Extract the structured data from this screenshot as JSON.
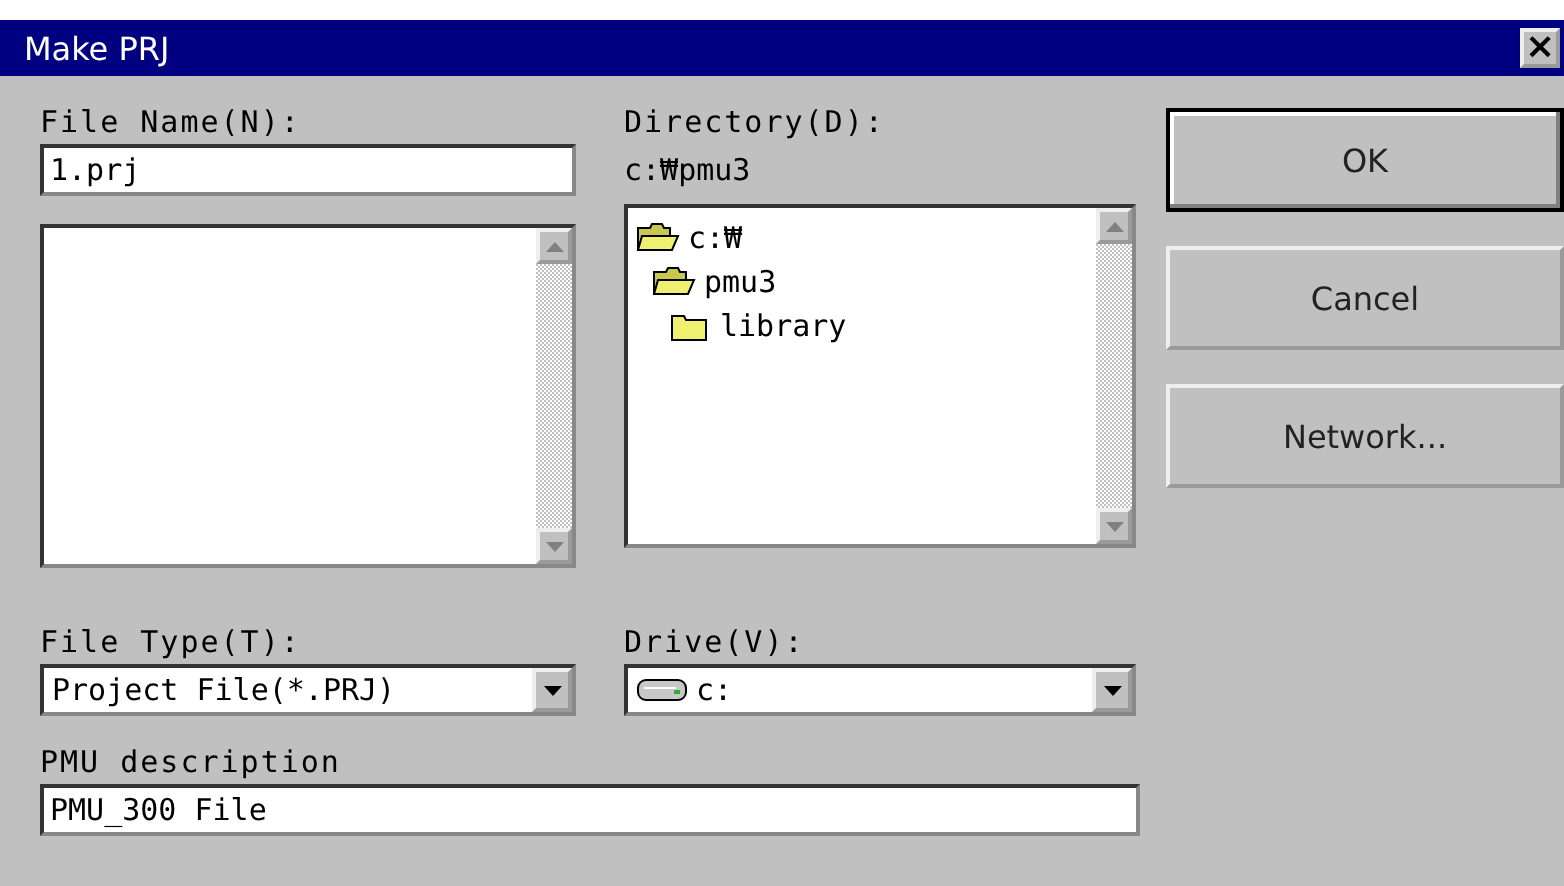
{
  "window": {
    "title": "Make PRJ",
    "close": "×"
  },
  "file_name": {
    "label": "File Name(N):",
    "value": "1.prj"
  },
  "directory": {
    "label": "Directory(D):",
    "path": "c:₩pmu3",
    "tree": [
      {
        "name": "c:₩",
        "expanded": true,
        "children": [
          {
            "name": "pmu3",
            "expanded": true,
            "children": [
              {
                "name": "library",
                "expanded": false
              }
            ]
          }
        ]
      }
    ]
  },
  "buttons": [
    "OK",
    "Cancel",
    "Network..."
  ],
  "file_type": {
    "label": "File Type(T):",
    "value": "Project File(*.PRJ)"
  },
  "drive": {
    "label": "Drive(V):",
    "value": "c:"
  },
  "description": {
    "label": "PMU description",
    "value": "PMU_300 File"
  }
}
